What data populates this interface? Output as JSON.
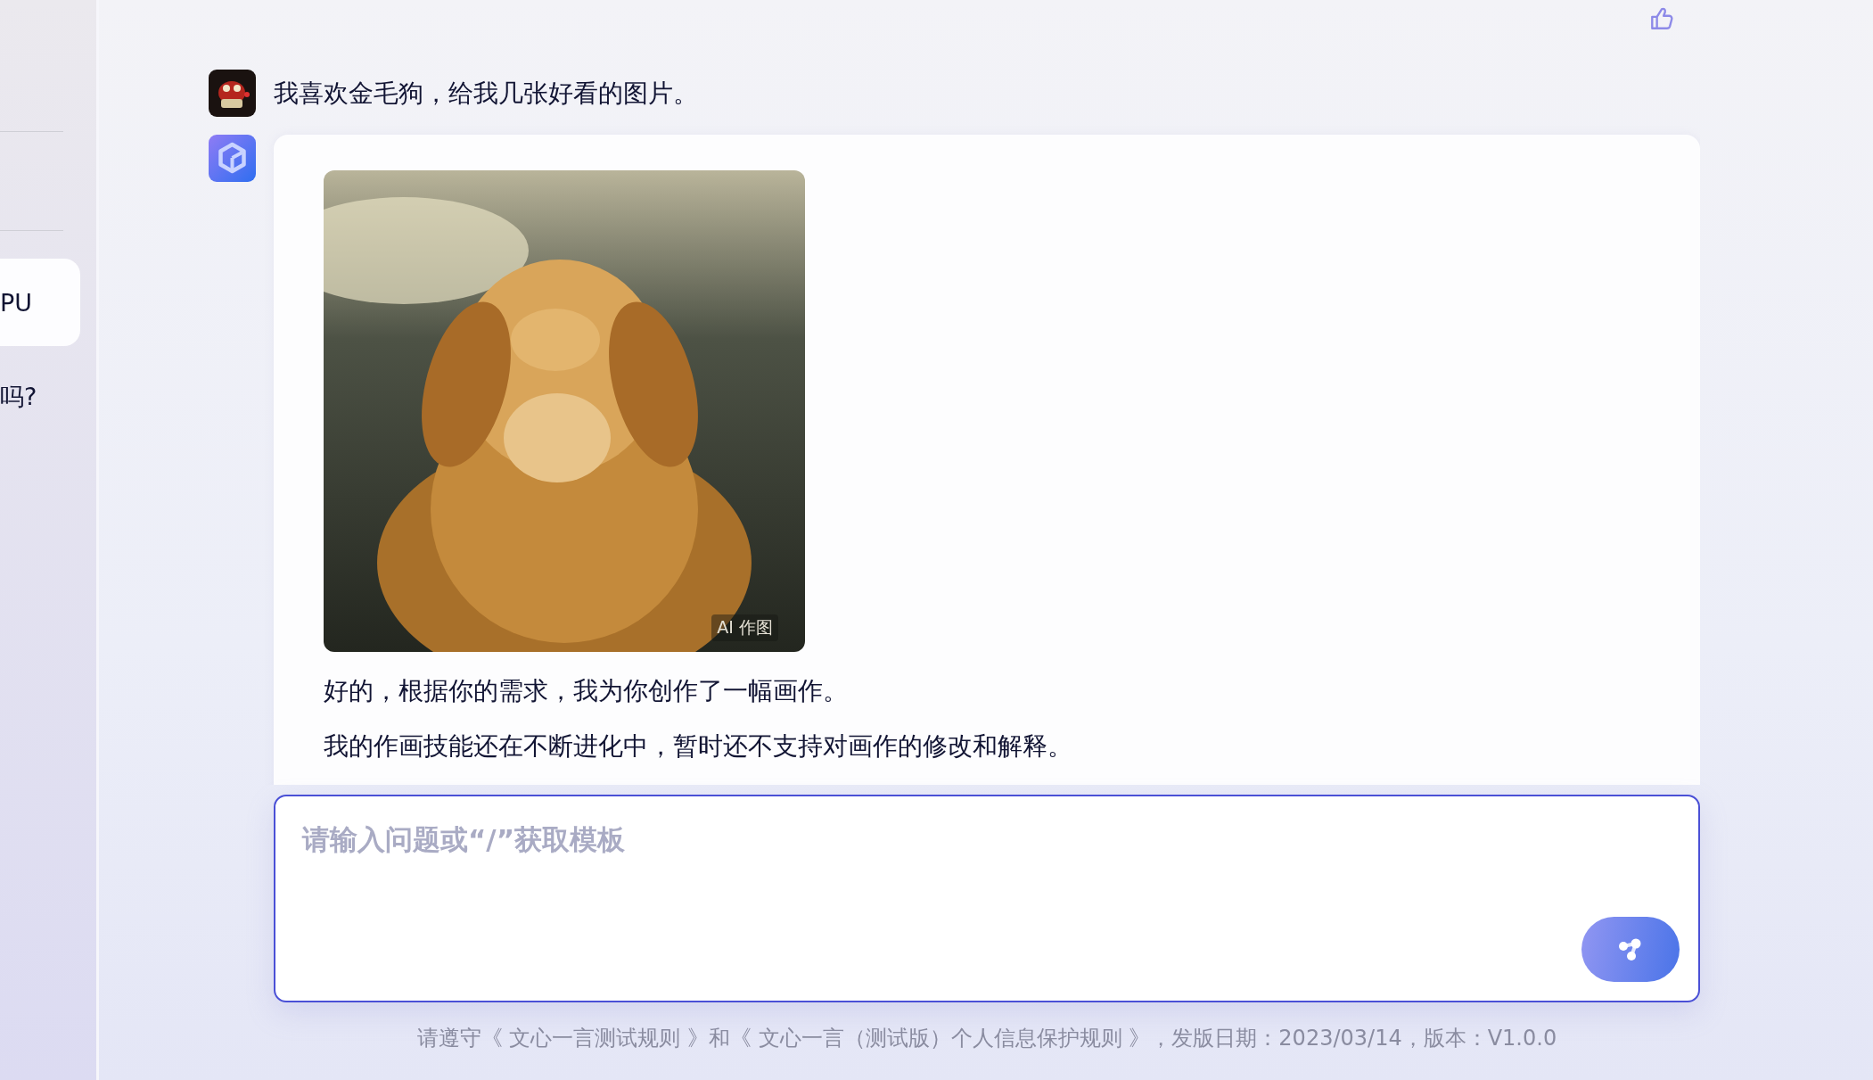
{
  "sidebar": {
    "items": [
      {
        "label": "PU",
        "selected": true
      },
      {
        "label": "吗?",
        "selected": false
      }
    ]
  },
  "messages": [
    {
      "kind": "user",
      "text": "我喜欢金毛狗，给我几张好看的图片。"
    },
    {
      "kind": "bot",
      "image": {
        "kind": "picture",
        "badge": "AI 作图"
      },
      "paragraphs": [
        "好的，根据你的需求，我为你创作了一幅画作。",
        "我的作画技能还在不断进化中，暂时还不支持对画作的修改和解释。"
      ]
    }
  ],
  "input": {
    "placeholder": "请输入问题或“/”获取模板"
  },
  "footer": "请遵守《 文心一言测试规则 》和《 文心一言（测试版）个人信息保护规则 》，发版日期：2023/03/14，版本：V1.0.0"
}
